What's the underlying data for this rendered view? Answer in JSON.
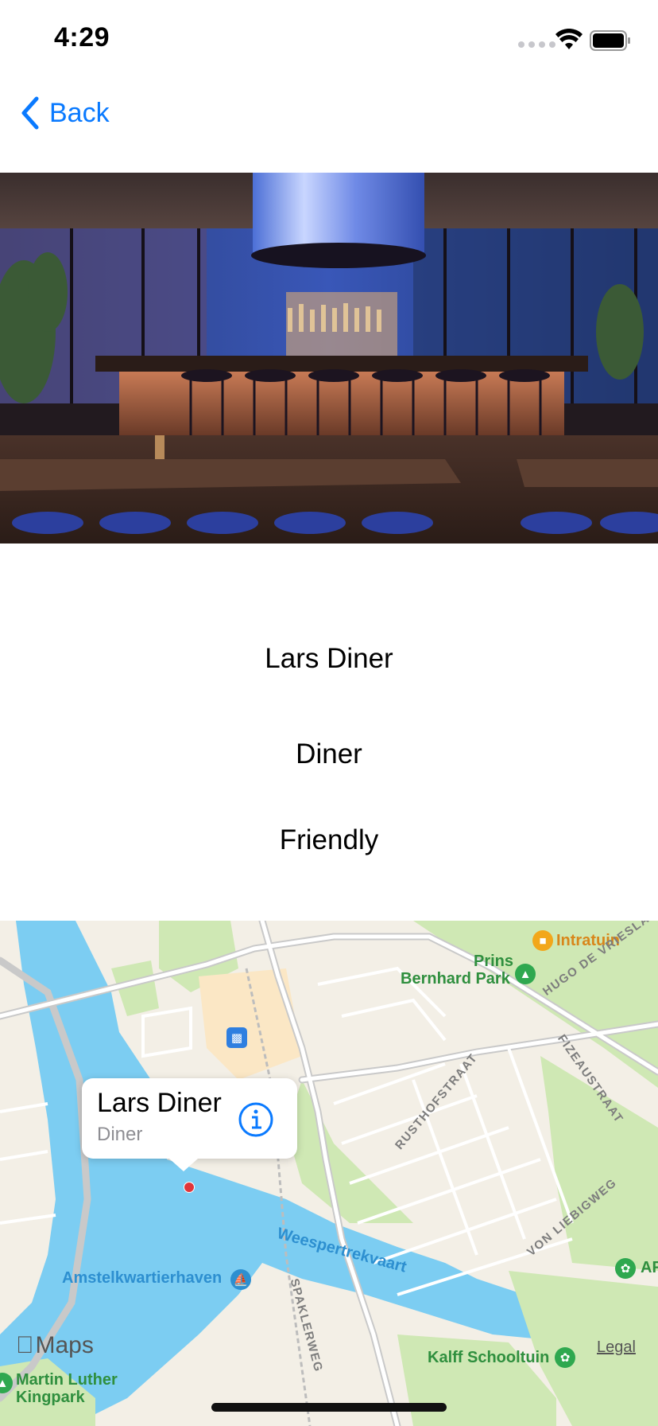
{
  "status_bar": {
    "time": "4:29"
  },
  "nav": {
    "back_label": "Back"
  },
  "restaurant": {
    "name": "Lars Diner",
    "type": "Diner",
    "characteristic": "Friendly"
  },
  "map": {
    "callout_title": "Lars Diner",
    "callout_subtitle": "Diner",
    "labels": {
      "intratuin": "Intratuin",
      "prins_bernhard_park_line1": "Prins",
      "prins_bernhard_park_line2": "Bernhard Park",
      "hugo_de_vrieslaan": "HUGO DE VRIESLAAN",
      "rusthofstraat": "RUSTHOFSTRAAT",
      "fizeaustraat": "FIZEAUSTRAAT",
      "von_liebigweg": "VON LIEBIGWEG",
      "weespertrekvaart": "Weespertrekvaart",
      "amstelkwartierhaven": "Amstelkwartierhaven",
      "spaklerweg": "SPAKLERWEG",
      "kalff_schooltuin": "Kalff Schooltuin",
      "martin_luther_line1": "Martin Luther",
      "martin_luther_line2": "Kingpark",
      "af_partial": "AF"
    },
    "attribution": "Maps",
    "legal": "Legal"
  },
  "colors": {
    "accent": "#0a7aff",
    "water": "#7ccdf2",
    "park": "#cfe8b4",
    "land": "#f3efe6",
    "pin": "#e0353a"
  }
}
